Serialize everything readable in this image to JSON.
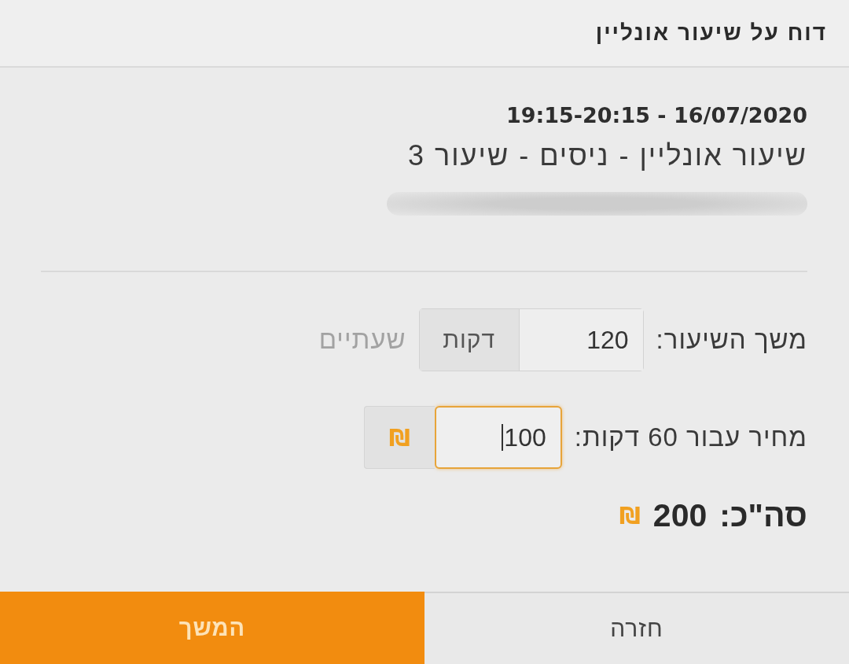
{
  "dialog": {
    "title": "דוח על שיעור אונליין"
  },
  "lesson": {
    "datetime": "19:15-20:15 - 16/07/2020",
    "name": "שיעור אונליין - ניסים - שיעור 3"
  },
  "fields": [
    {
      "kind": "duration",
      "label": "משך השיעור:",
      "value": "120",
      "unit": "דקות",
      "hint": "שעתיים",
      "focused": false
    },
    {
      "kind": "price",
      "label": "מחיר עבור 60 דקות:",
      "value": "100",
      "currency": "₪",
      "focused": true
    }
  ],
  "total": {
    "label": "סה\"כ:",
    "amount": "200",
    "currency": "₪"
  },
  "buttons": [
    {
      "label": "חזרה",
      "kind": "secondary"
    },
    {
      "label": "המשך",
      "kind": "primary"
    }
  ]
}
